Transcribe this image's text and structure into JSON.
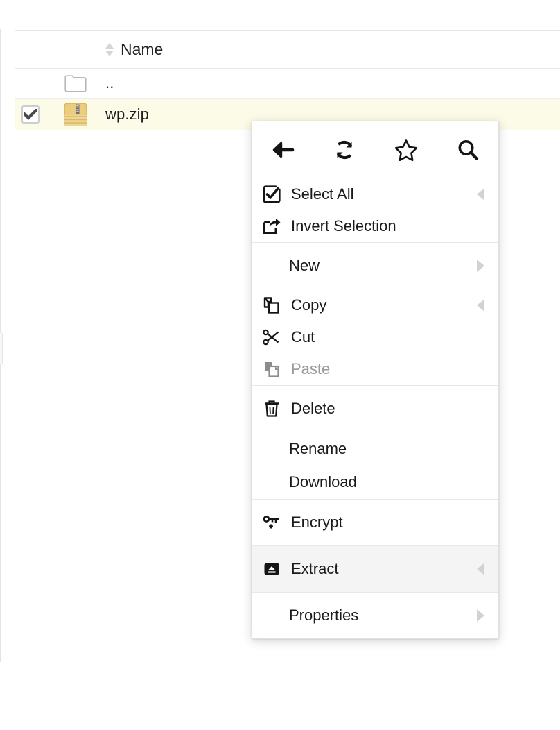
{
  "file_list": {
    "columns": [
      {
        "key": "check",
        "label": ""
      },
      {
        "key": "icon",
        "label": ""
      },
      {
        "key": "name",
        "label": "Name"
      }
    ],
    "sort_indicator": "sort-updown-icon",
    "rows": [
      {
        "icon": "folder-icon",
        "name": "..",
        "checked": false,
        "selected": false
      },
      {
        "icon": "zip-file-icon",
        "name": "wp.zip",
        "checked": true,
        "selected": true
      }
    ]
  },
  "context_menu": {
    "toolbar": [
      {
        "name": "back-icon",
        "label": "Back"
      },
      {
        "name": "refresh-icon",
        "label": "Refresh"
      },
      {
        "name": "star-icon",
        "label": "Favorite"
      },
      {
        "name": "search-icon",
        "label": "Search"
      }
    ],
    "groups": [
      {
        "items": [
          {
            "label": "Select All",
            "icon": "checkbox-checked-icon",
            "arrow": "left",
            "disabled": false,
            "hover": false
          },
          {
            "label": "Invert Selection",
            "icon": "invert-selection-icon",
            "arrow": "none",
            "disabled": false,
            "hover": false
          }
        ]
      },
      {
        "items": [
          {
            "label": "New",
            "icon": "none",
            "arrow": "right",
            "disabled": false,
            "hover": false
          }
        ]
      },
      {
        "items": [
          {
            "label": "Copy",
            "icon": "copy-icon",
            "arrow": "left",
            "disabled": false,
            "hover": false
          },
          {
            "label": "Cut",
            "icon": "scissors-icon",
            "arrow": "none",
            "disabled": false,
            "hover": false
          },
          {
            "label": "Paste",
            "icon": "paste-icon",
            "arrow": "none",
            "disabled": true,
            "hover": false
          }
        ]
      },
      {
        "items": [
          {
            "label": "Delete",
            "icon": "trash-icon",
            "arrow": "none",
            "disabled": false,
            "hover": false
          }
        ]
      },
      {
        "items": [
          {
            "label": "Rename",
            "icon": "none",
            "arrow": "none",
            "disabled": false,
            "hover": false
          },
          {
            "label": "Download",
            "icon": "none",
            "arrow": "none",
            "disabled": false,
            "hover": false
          }
        ]
      },
      {
        "items": [
          {
            "label": "Encrypt",
            "icon": "key-icon",
            "arrow": "none",
            "disabled": false,
            "hover": false
          }
        ]
      },
      {
        "items": [
          {
            "label": "Extract",
            "icon": "extract-icon",
            "arrow": "left",
            "disabled": false,
            "hover": true
          }
        ]
      },
      {
        "items": [
          {
            "label": "Properties",
            "icon": "none",
            "arrow": "right",
            "disabled": false,
            "hover": false
          }
        ]
      }
    ]
  },
  "colors": {
    "selected_row_bg": "#fbfbe8",
    "hover_bg": "#f4f4f4",
    "border": "#e7e7e7",
    "text": "#1a1a1a",
    "disabled_text": "#9a9a9a",
    "zip_icon": "#e8c874"
  }
}
